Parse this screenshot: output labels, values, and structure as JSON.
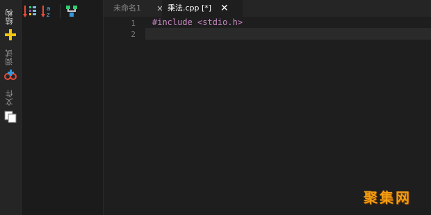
{
  "sidebar": {
    "tabs": [
      {
        "label": "结构"
      },
      {
        "label": "调试"
      },
      {
        "label": "文件"
      }
    ]
  },
  "editor": {
    "tabs": [
      {
        "label": "未命名1",
        "close": "×"
      },
      {
        "label": "乘法.cpp [*]",
        "close": "✕"
      }
    ],
    "line_numbers": [
      "1",
      "2"
    ],
    "code_lines": [
      "#include <stdio.h>",
      ""
    ]
  },
  "colors": {
    "preprocessor": "#c586c0",
    "watermark": "#f39c12"
  },
  "watermark": "聚集网"
}
